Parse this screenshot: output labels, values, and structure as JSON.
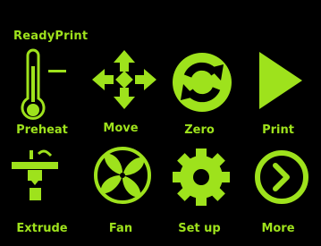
{
  "app": {
    "title": "ReadyPrint"
  },
  "theme": {
    "accent": "#9ee21c",
    "background": "#000000"
  },
  "menu": [
    {
      "label": "Preheat",
      "icon": "thermometer-icon"
    },
    {
      "label": "Move",
      "icon": "move-arrows-icon"
    },
    {
      "label": "Zero",
      "icon": "refresh-icon"
    },
    {
      "label": "Print",
      "icon": "play-icon"
    },
    {
      "label": "Extrude",
      "icon": "extruder-icon"
    },
    {
      "label": "Fan",
      "icon": "fan-icon"
    },
    {
      "label": "Set up",
      "icon": "gear-icon"
    },
    {
      "label": "More",
      "icon": "chevron-circle-icon"
    }
  ]
}
